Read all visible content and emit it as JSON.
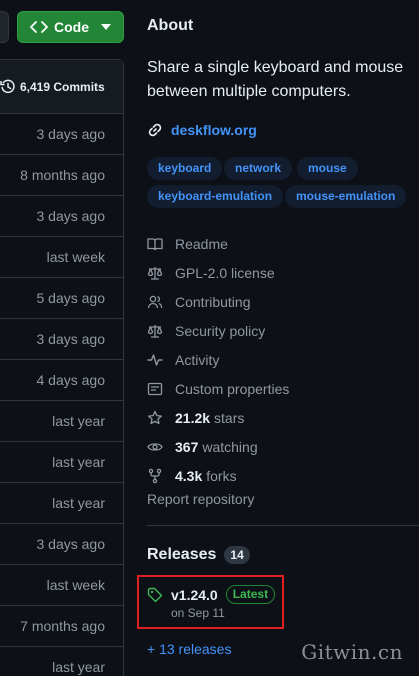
{
  "code_button": {
    "label": "Code"
  },
  "commits": {
    "count_label": "6,419 Commits"
  },
  "file_rows": [
    {
      "age": "3 days ago"
    },
    {
      "age": "8 months ago"
    },
    {
      "age": "3 days ago"
    },
    {
      "age": "last week"
    },
    {
      "age": "5 days ago"
    },
    {
      "age": "3 days ago"
    },
    {
      "age": "4 days ago"
    },
    {
      "age": "last year"
    },
    {
      "age": "last year"
    },
    {
      "age": "last year"
    },
    {
      "age": "3 days ago"
    },
    {
      "age": "last week"
    },
    {
      "age": "7 months ago"
    },
    {
      "age": "last year"
    }
  ],
  "about": {
    "title": "About",
    "description": "Share a single keyboard and mouse between multiple computers.",
    "website": "deskflow.org",
    "topics": [
      "keyboard",
      "network",
      "mouse",
      "keyboard-emulation",
      "mouse-emulation"
    ],
    "links": [
      {
        "icon": "book-icon",
        "label": "Readme"
      },
      {
        "icon": "law-icon",
        "label": "GPL-2.0 license"
      },
      {
        "icon": "people-icon",
        "label": "Contributing"
      },
      {
        "icon": "law-icon",
        "label": "Security policy"
      },
      {
        "icon": "pulse-icon",
        "label": "Activity"
      },
      {
        "icon": "note-icon",
        "label": "Custom properties"
      }
    ],
    "stars": {
      "value": "21.2k",
      "label": "stars"
    },
    "watching": {
      "value": "367",
      "label": "watching"
    },
    "forks": {
      "value": "4.3k",
      "label": "forks"
    },
    "report": "Report repository"
  },
  "releases": {
    "title": "Releases",
    "count": "14",
    "latest": {
      "tag": "v1.24.0",
      "badge": "Latest",
      "date": "on Sep 11"
    },
    "more": "+ 13 releases"
  },
  "watermark": "Gitwin.cn",
  "colors": {
    "background": "#0d1117",
    "accent_link": "#4493f8",
    "code_button": "#238636",
    "latest_badge": "#3fb950",
    "highlight_box": "#e02020"
  }
}
